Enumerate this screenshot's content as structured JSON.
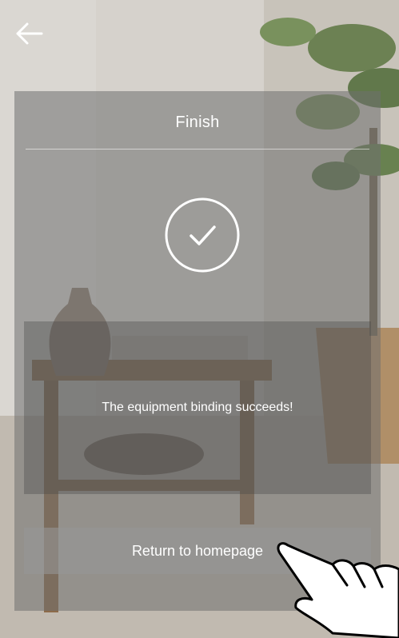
{
  "header": {
    "back_icon": "arrow-left-icon"
  },
  "panel": {
    "title": "Finish",
    "status_icon": "check-circle-icon",
    "message": "The equipment binding succeeds!",
    "return_button_label": "Return to homepage"
  },
  "colors": {
    "panel_overlay": "#707070",
    "text": "#ffffff",
    "button_bg": "#969696"
  },
  "decor": {
    "pointer_icon": "pointing-hand-icon"
  }
}
